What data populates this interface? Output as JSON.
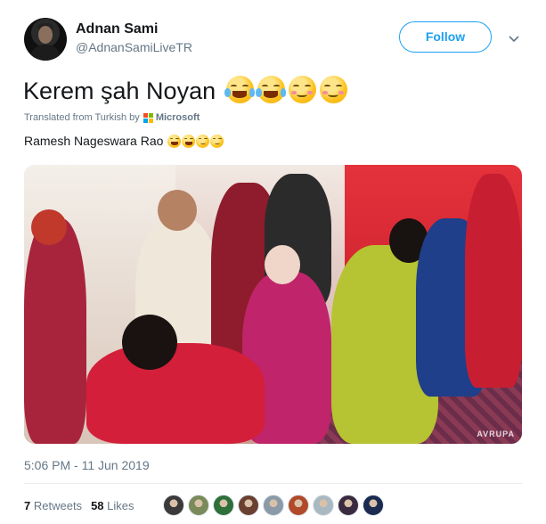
{
  "user": {
    "display_name": "Adnan Sami",
    "handle": "@AdnanSamiLiveTR"
  },
  "follow_label": "Follow",
  "tweet": {
    "text": "Kerem şah Noyan",
    "emojis": [
      "face-with-tears-of-joy",
      "face-with-tears-of-joy",
      "smiling-face-with-smiling-eyes",
      "smiling-face-with-smiling-eyes"
    ]
  },
  "translation": {
    "label": "Translated from Turkish by",
    "provider": "Microsoft",
    "text": "Ramesh Nageswara Rao"
  },
  "media": {
    "watermark": "AVRUPA"
  },
  "timestamp": "5:06 PM - 11 Jun 2019",
  "stats": {
    "retweets_count": "7",
    "retweets_label": "Retweets",
    "likes_count": "58",
    "likes_label": "Likes"
  },
  "likers": [
    {
      "color": "#3a3a3a"
    },
    {
      "color": "#7a8a5a"
    },
    {
      "color": "#2f6f3a"
    },
    {
      "color": "#6a4030"
    },
    {
      "color": "#8a9aa8"
    },
    {
      "color": "#b04a2a"
    },
    {
      "color": "#aab8c2"
    },
    {
      "color": "#3a2a40"
    },
    {
      "color": "#1a2a50"
    }
  ],
  "colors": {
    "accent": "#1da1f2",
    "secondary_text": "#657786",
    "primary_text": "#14171a"
  }
}
